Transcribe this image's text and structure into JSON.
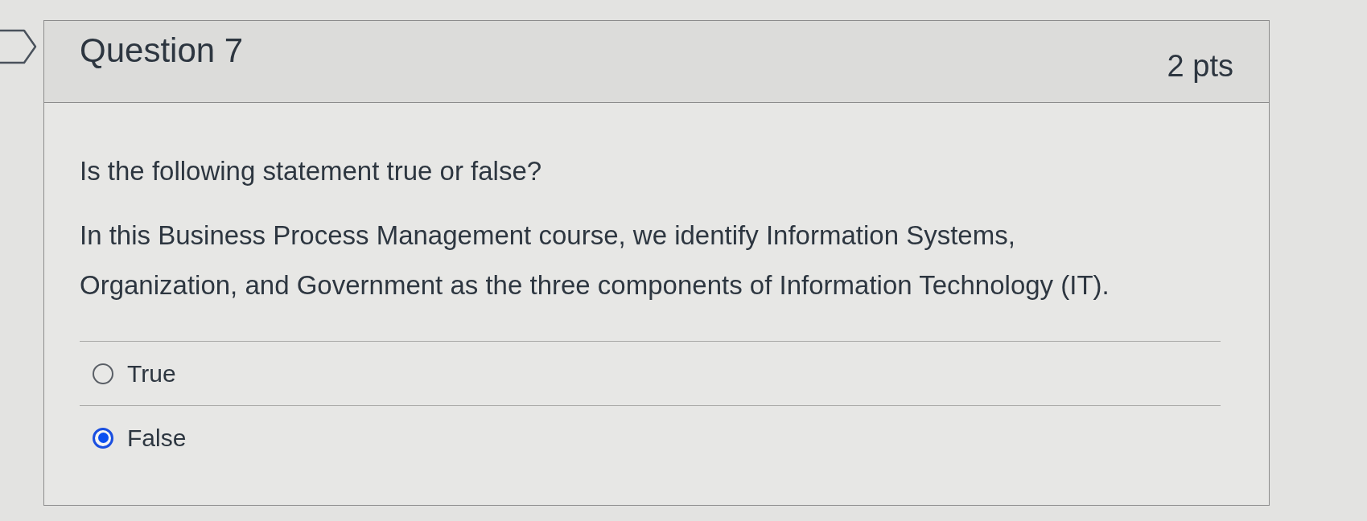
{
  "question": {
    "title": "Question 7",
    "points": "2 pts"
  },
  "prompt": "Is the following statement true or false?",
  "statement": "In this Business Process Management course, we identify Information Systems, Organization, and Government as the three components of Information Technology (IT).",
  "answers": [
    {
      "label": "True",
      "selected": false
    },
    {
      "label": "False",
      "selected": true
    }
  ]
}
